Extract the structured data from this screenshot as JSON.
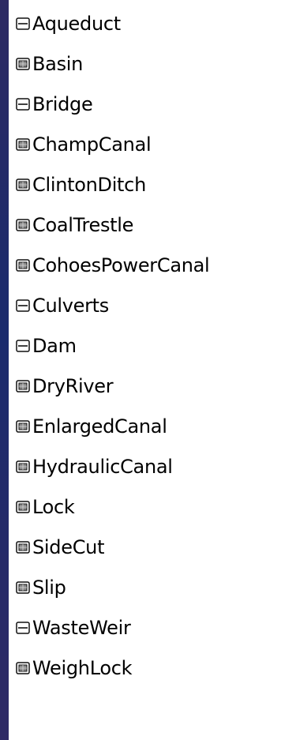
{
  "layer_list": {
    "items": [
      {
        "label": "Aqueduct",
        "icon": "line-symbol-icon"
      },
      {
        "label": "Basin",
        "icon": "polygon-symbol-icon"
      },
      {
        "label": "Bridge",
        "icon": "line-symbol-icon"
      },
      {
        "label": "ChampCanal",
        "icon": "polygon-symbol-icon"
      },
      {
        "label": "ClintonDitch",
        "icon": "polygon-symbol-icon"
      },
      {
        "label": "CoalTrestle",
        "icon": "polygon-symbol-icon"
      },
      {
        "label": "CohoesPowerCanal",
        "icon": "polygon-symbol-icon"
      },
      {
        "label": "Culverts",
        "icon": "line-symbol-icon"
      },
      {
        "label": "Dam",
        "icon": "line-symbol-icon"
      },
      {
        "label": "DryRiver",
        "icon": "polygon-symbol-icon"
      },
      {
        "label": "EnlargedCanal",
        "icon": "polygon-symbol-icon"
      },
      {
        "label": "HydraulicCanal",
        "icon": "polygon-symbol-icon"
      },
      {
        "label": "Lock",
        "icon": "polygon-symbol-icon"
      },
      {
        "label": "SideCut",
        "icon": "polygon-symbol-icon"
      },
      {
        "label": "Slip",
        "icon": "polygon-symbol-icon"
      },
      {
        "label": "WasteWeir",
        "icon": "line-symbol-icon"
      },
      {
        "label": "WeighLock",
        "icon": "polygon-symbol-icon"
      }
    ]
  },
  "colors": {
    "background": "#222b66",
    "list_background": "#ffffff",
    "text": "#000000"
  }
}
